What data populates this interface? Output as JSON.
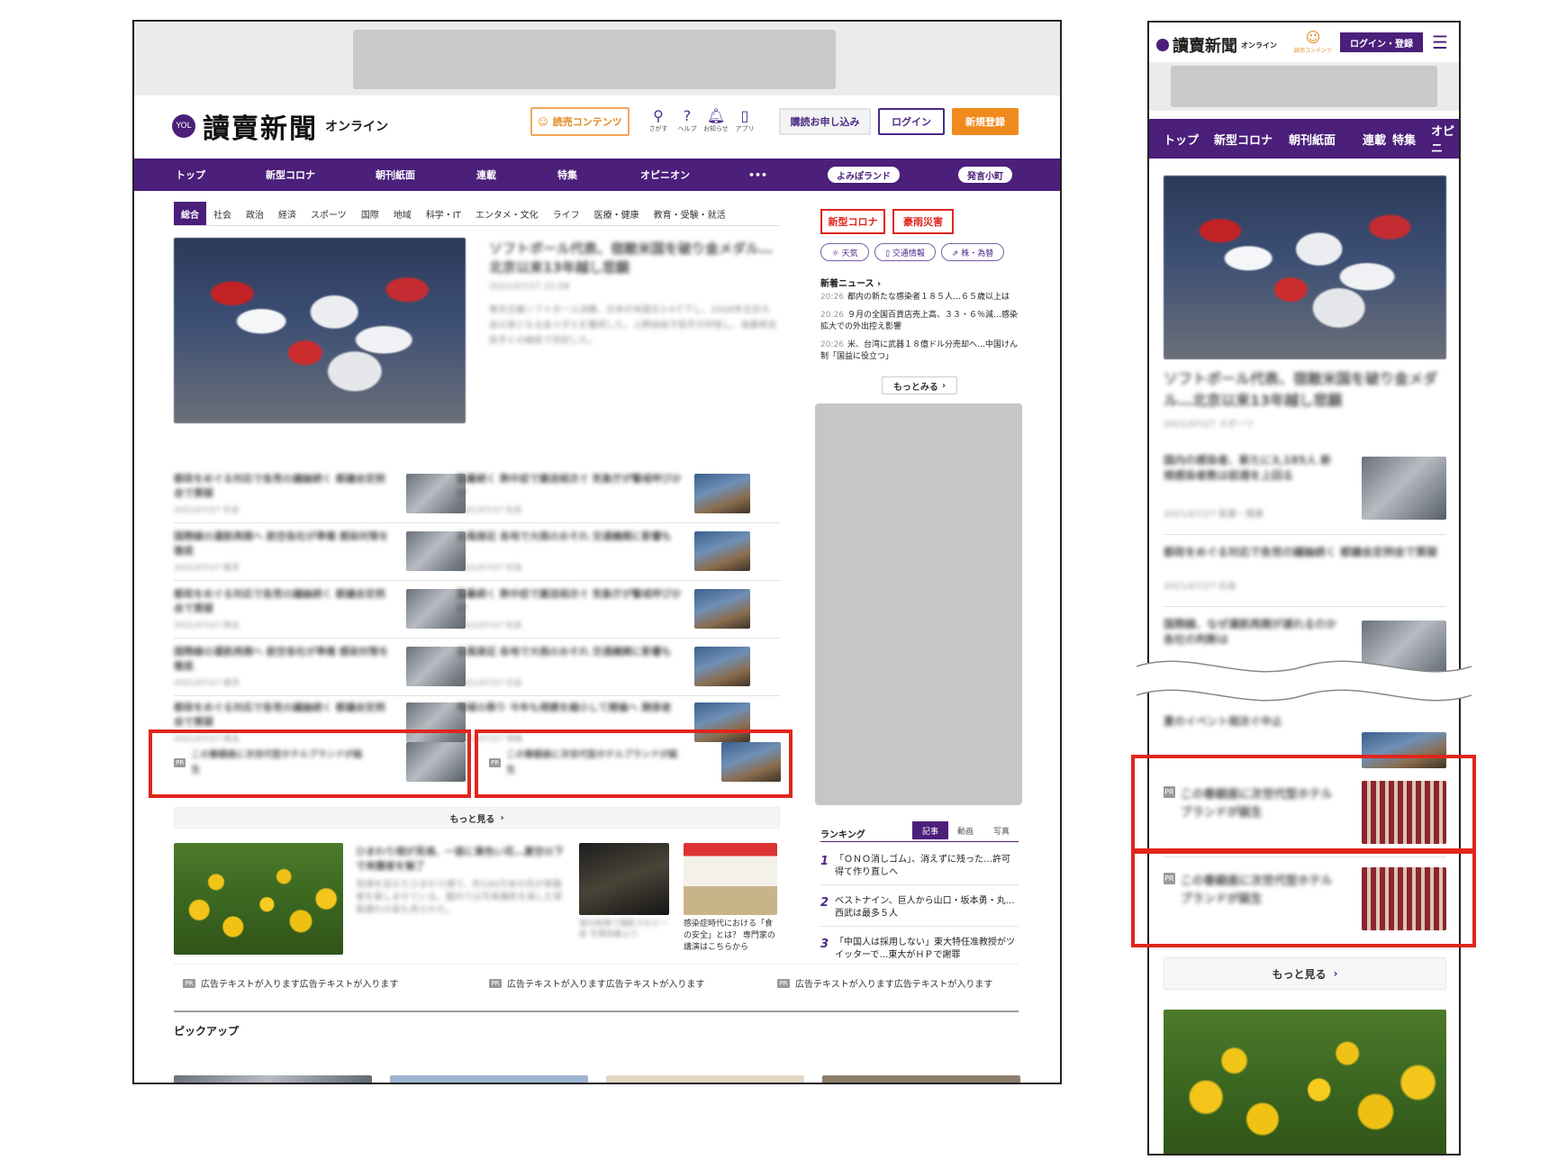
{
  "desktop": {
    "logo": {
      "badge": "YOL",
      "name": "讀賣新聞",
      "sub": "オンライン"
    },
    "header": {
      "content_btn": "読売コンテンツ",
      "icons": [
        {
          "icon": "search-icon",
          "glyph": "⚲",
          "label": "さがす"
        },
        {
          "icon": "help-icon",
          "glyph": "?",
          "label": "ヘルプ"
        },
        {
          "icon": "bell-icon",
          "glyph": "🔔︎",
          "label": "お知らせ"
        },
        {
          "icon": "app-icon",
          "glyph": "▯",
          "label": "アプリ"
        }
      ],
      "subscribe": "購読お申し込み",
      "login": "ログイン",
      "register": "新規登録"
    },
    "nav": {
      "items": [
        "トップ",
        "新型コロナ",
        "朝刊紙面",
        "連載",
        "特集",
        "オピニオン",
        "•••"
      ],
      "pill1": "よみぽランド",
      "pill2": "発言小町"
    },
    "subnav": [
      "総合",
      "社会",
      "政治",
      "経済",
      "スポーツ",
      "国際",
      "地域",
      "科学・IT",
      "エンタメ・文化",
      "ライフ",
      "医療・健康",
      "教育・受験・就活"
    ],
    "headline": "ソフトボール代表、宿敵米国を破り金メダル…北京以来13年越し悲願",
    "headline_meta": "2021/07/27 22:58",
    "headline_body": "東京五輪ソフトボール決勝、日本が米国を2-0で下し、2008年北京大会以来となる金メダルを獲得した。上野由岐子投手が好投し、後藤希友投手との継投で完封した。",
    "articles": [
      {
        "title": "都政をめぐる対応で各党の議論続く 都議会定例会で質疑",
        "meta": "2021/07/27 社会"
      },
      {
        "title": "猛暑続く 熱中症で搬送相次ぐ 気象庁が警戒呼びかけ",
        "meta": "2021/07/27 社会"
      },
      {
        "title": "国際線の運航再開へ 航空各社が準備 感染対策を徹底",
        "meta": "2021/07/27 経済"
      },
      {
        "title": "台風接近 各地で大雨のおそれ 交通機関に影響も",
        "meta": "2021/07/27 社会"
      },
      {
        "title": "都政をめぐる対応で各党の議論続く 都議会定例会で質疑",
        "meta": "2021/07/27 政治"
      },
      {
        "title": "猛暑続く 熱中症で搬送相次ぐ 気象庁が警戒呼びかけ",
        "meta": "2021/07/27 社会"
      },
      {
        "title": "国際線の運航再開へ 航空各社が準備 感染対策を徹底",
        "meta": "2021/07/27 経済"
      },
      {
        "title": "台風接近 各地で大雨のおそれ 交通機関に影響も",
        "meta": "2021/07/27 社会"
      },
      {
        "title": "都政をめぐる対応で各党の議論続く 都議会定例会で質疑",
        "meta": "2021/07/27 政治"
      },
      {
        "title": "地域の祭り 今年も規模を縮小して開催へ 関係者",
        "meta": "2021/07/27 地域"
      }
    ],
    "pr1": "この春銀座に次世代型ホテルブランドが誕生",
    "pr2": "この春銀座に次世代型ホテルブランドが誕生",
    "pr_tag": "PR",
    "more": "もっと見る",
    "feature_title": "ひまわり畑が見頃、一面に黄色い花…夏空の下で来園者を魅了",
    "feature_body": "見頃を迎えたひまわり畑で、約100万本の花が来園者を楽しませている。園内では写真撮影を楽しむ家族連れの姿も見られた。",
    "poster_caption": "感染症時代における「食の安全」とは？ 専門家の講演はこちらから",
    "dark_caption": "夜の街角で撮影された一枚 写真特集より",
    "ad_texts": [
      "広告テキストが入ります広告テキストが入ります",
      "広告テキストが入ります広告テキストが入ります",
      "広告テキストが入ります広告テキストが入ります"
    ],
    "pickup": "ピックアップ",
    "side": {
      "btn1": "新型コロナ",
      "btn2": "豪雨災害",
      "chips": [
        "☼ 天気",
        "▯ 交通情報",
        "⇗ 株・為替"
      ],
      "news_title": "新着ニュース",
      "news": [
        {
          "date": "20:26",
          "text": "都内の新たな感染者１８５人…６５歳以上は"
        },
        {
          "date": "20:26",
          "text": "９月の全国百貨店売上高、３３・６％減…感染拡大での外出控え影響"
        },
        {
          "date": "20:26",
          "text": "米、台湾に武器１８億ドル分売却へ…中国けん制「国益に役立つ」"
        }
      ],
      "news_more": "もっとみる",
      "ranking_title": "ランキング",
      "ranking_tabs": [
        "記事",
        "動画",
        "写真"
      ],
      "ranking": [
        {
          "num": "1",
          "text": "「ＯＮＯ消しゴム」、消えずに残った…許可得て作り直しへ"
        },
        {
          "num": "2",
          "text": "ベストナイン、巨人から山口・坂本勇・丸…西武は最多５人"
        },
        {
          "num": "3",
          "text": "「中国人は採用しない」東大特任准教授がツイッターで…東大がＨＰで謝罪"
        }
      ]
    }
  },
  "mobile": {
    "logo_name": "讀賣新聞",
    "logo_sub": "オンライン",
    "content_label": "読売コンテンツ",
    "login": "ログイン・登録",
    "tabs": [
      "トップ",
      "新型コロナ",
      "朝刊紙面",
      "連載",
      "特集",
      "オピニ"
    ],
    "headline": "ソフトボール代表、宿敵米国を破り金メダル…北京以来13年越し悲願",
    "headline_meta": "2021/07/27 スポーツ",
    "articles": [
      {
        "title": "国内の感染者、新たに3,185人 新規感染者数は前週を上回る",
        "meta": "2021/07/27 医療・健康"
      },
      {
        "title": "都政をめぐる対応で各党の議論続く 都議会定例会で質疑",
        "meta": "2021/07/27 社会"
      },
      {
        "title": "国際線、なぜ運航再開が遅れるのか 各社の判断は",
        "meta": "2021/07/27 経済"
      },
      {
        "title": "夏のイベント相次ぐ中止",
        "meta": ""
      }
    ],
    "pr_tag": "PR",
    "pr1": "この春銀座に次世代型ホテルブランドが誕生",
    "pr2": "この春銀座に次世代型ホテルブランドが誕生",
    "more": "もっと見る"
  },
  "colors": {
    "brand": "#4b1f7a",
    "highlight": "#e0261c",
    "accent_orange": "#f08a1c"
  }
}
